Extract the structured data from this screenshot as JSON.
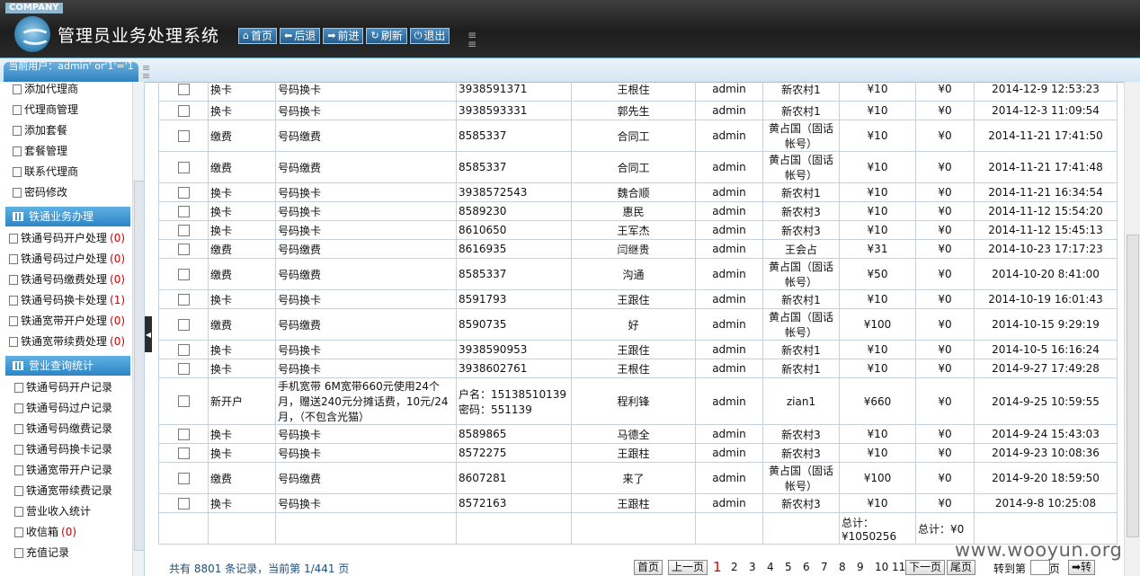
{
  "header": {
    "company": "COMPANY",
    "title": "管理员业务处理系统",
    "nav": [
      {
        "icon": "home-icon",
        "glyph": "⌂",
        "label": "首页"
      },
      {
        "icon": "back-icon",
        "glyph": "⬅",
        "label": "后退"
      },
      {
        "icon": "forward-icon",
        "glyph": "➡",
        "label": "前进"
      },
      {
        "icon": "refresh-icon",
        "glyph": "↻",
        "label": "刷新"
      },
      {
        "icon": "power-icon",
        "glyph": "⏻",
        "label": "退出"
      }
    ]
  },
  "user": {
    "text": "当前用户：admin' or'1'='1"
  },
  "sidebar": {
    "top_items": [
      "添加代理商",
      "代理商管理",
      "添加套餐",
      "套餐管理",
      "联系代理商",
      "密码修改"
    ],
    "section1": {
      "title": "铁通业务办理",
      "items": [
        {
          "label": "铁通号码开户处理",
          "count": "(0)"
        },
        {
          "label": "铁通号码过户处理",
          "count": "(0)"
        },
        {
          "label": "铁通号码缴费处理",
          "count": "(0)"
        },
        {
          "label": "铁通号码换卡处理",
          "count": "(1)"
        },
        {
          "label": "铁通宽带开户处理",
          "count": "(0)"
        },
        {
          "label": "铁通宽带续费处理",
          "count": "(0)"
        }
      ]
    },
    "section2": {
      "title": "营业查询统计",
      "items": [
        {
          "label": "铁通号码开户记录",
          "count": ""
        },
        {
          "label": "铁通号码过户记录",
          "count": ""
        },
        {
          "label": "铁通号码缴费记录",
          "count": ""
        },
        {
          "label": "铁通号码换卡记录",
          "count": ""
        },
        {
          "label": "铁通宽带开户记录",
          "count": ""
        },
        {
          "label": "铁通宽带续费记录",
          "count": ""
        },
        {
          "label": "营业收入统计",
          "count": ""
        },
        {
          "label": "收信箱",
          "count": "(0)"
        },
        {
          "label": "充值记录",
          "count": ""
        }
      ]
    }
  },
  "table": {
    "rows": [
      {
        "type": "换卡",
        "item": "号码换卡",
        "number": "3938591371",
        "name": "王根住",
        "op": "admin",
        "agent": "新农村1",
        "amount": "¥10",
        "fee": "¥0",
        "time": "2014-12-9 12:53:23",
        "h": 27
      },
      {
        "type": "换卡",
        "item": "号码换卡",
        "number": "3938593331",
        "name": "郭先生",
        "op": "admin",
        "agent": "新农村1",
        "amount": "¥10",
        "fee": "¥0",
        "time": "2014-12-3 11:09:54",
        "h": 21
      },
      {
        "type": "缴费",
        "item": "号码缴费",
        "number": "8585337",
        "name": "合同工",
        "op": "admin",
        "agent": "黄占国（固话帐号）",
        "amount": "¥10",
        "fee": "¥0",
        "time": "2014-11-21 17:41:50",
        "h": 35
      },
      {
        "type": "缴费",
        "item": "号码缴费",
        "number": "8585337",
        "name": "合同工",
        "op": "admin",
        "agent": "黄占国（固话帐号）",
        "amount": "¥10",
        "fee": "¥0",
        "time": "2014-11-21 17:41:48",
        "h": 35
      },
      {
        "type": "换卡",
        "item": "号码换卡",
        "number": "3938572543",
        "name": "魏合顺",
        "op": "admin",
        "agent": "新农村1",
        "amount": "¥10",
        "fee": "¥0",
        "time": "2014-11-21 16:34:54",
        "h": 21
      },
      {
        "type": "换卡",
        "item": "号码换卡",
        "number": "8589230",
        "name": "惠民",
        "op": "admin",
        "agent": "新农村3",
        "amount": "¥10",
        "fee": "¥0",
        "time": "2014-11-12 15:54:20",
        "h": 21
      },
      {
        "type": "换卡",
        "item": "号码换卡",
        "number": "8610650",
        "name": "王军杰",
        "op": "admin",
        "agent": "新农村3",
        "amount": "¥10",
        "fee": "¥0",
        "time": "2014-11-12 15:45:13",
        "h": 21
      },
      {
        "type": "缴费",
        "item": "号码缴费",
        "number": "8616935",
        "name": "闫继贵",
        "op": "admin",
        "agent": "王会占",
        "amount": "¥31",
        "fee": "¥0",
        "time": "2014-10-23 17:17:23",
        "h": 21
      },
      {
        "type": "缴费",
        "item": "号码缴费",
        "number": "8585337",
        "name": "沟通",
        "op": "admin",
        "agent": "黄占国（固话帐号）",
        "amount": "¥50",
        "fee": "¥0",
        "time": "2014-10-20 8:41:00",
        "h": 35
      },
      {
        "type": "换卡",
        "item": "号码换卡",
        "number": "8591793",
        "name": "王跟住",
        "op": "admin",
        "agent": "新农村1",
        "amount": "¥10",
        "fee": "¥0",
        "time": "2014-10-19 16:01:43",
        "h": 21
      },
      {
        "type": "缴费",
        "item": "号码缴费",
        "number": "8590735",
        "name": "好",
        "op": "admin",
        "agent": "黄占国（固话帐号）",
        "amount": "¥100",
        "fee": "¥0",
        "time": "2014-10-15 9:29:19",
        "h": 35
      },
      {
        "type": "换卡",
        "item": "号码换卡",
        "number": "3938590953",
        "name": "王跟住",
        "op": "admin",
        "agent": "新农村1",
        "amount": "¥10",
        "fee": "¥0",
        "time": "2014-10-5 16:16:24",
        "h": 21
      },
      {
        "type": "换卡",
        "item": "号码换卡",
        "number": "3938602761",
        "name": "王根住",
        "op": "admin",
        "agent": "新农村1",
        "amount": "¥10",
        "fee": "¥0",
        "time": "2014-9-27 17:49:28",
        "h": 21
      },
      {
        "type": "新开户",
        "item": "手机宽带 6M宽带660元使用24个月，赠送240元分摊话费，10元/24月，（不包含光猫）",
        "number": "户名：15138510139 密码：551139",
        "name": "程利锋",
        "op": "admin",
        "agent": "zian1",
        "amount": "¥660",
        "fee": "¥0",
        "time": "2014-9-25 10:59:55",
        "h": 52
      },
      {
        "type": "换卡",
        "item": "号码换卡",
        "number": "8589865",
        "name": "马德全",
        "op": "admin",
        "agent": "新农村3",
        "amount": "¥10",
        "fee": "¥0",
        "time": "2014-9-24 15:43:03",
        "h": 21
      },
      {
        "type": "换卡",
        "item": "号码换卡",
        "number": "8572275",
        "name": "王跟柱",
        "op": "admin",
        "agent": "新农村3",
        "amount": "¥10",
        "fee": "¥0",
        "time": "2014-9-23 10:08:36",
        "h": 21
      },
      {
        "type": "缴费",
        "item": "号码缴费",
        "number": "8607281",
        "name": "来了",
        "op": "admin",
        "agent": "黄占国（固话帐号）",
        "amount": "¥100",
        "fee": "¥0",
        "time": "2014-9-20 18:59:50",
        "h": 35
      },
      {
        "type": "换卡",
        "item": "号码换卡",
        "number": "8572163",
        "name": "王跟柱",
        "op": "admin",
        "agent": "新农村3",
        "amount": "¥10",
        "fee": "¥0",
        "time": "2014-9-8 10:25:08",
        "h": 21
      }
    ],
    "total_amount": "总计：¥1050256",
    "total_fee": "总计：¥0"
  },
  "pager": {
    "info": "共有 8801 条记录，当前第 1/441 页",
    "first": "首页",
    "prev": "上一页",
    "pages": [
      "1",
      "2",
      "3",
      "4",
      "5",
      "6",
      "7",
      "8",
      "9",
      "10",
      "11"
    ],
    "current": "1",
    "next": "下一页",
    "last": "尾页",
    "goto_label": "转到第",
    "page_unit": "页",
    "go": "➡转"
  },
  "watermark": "www.wooyun.org"
}
